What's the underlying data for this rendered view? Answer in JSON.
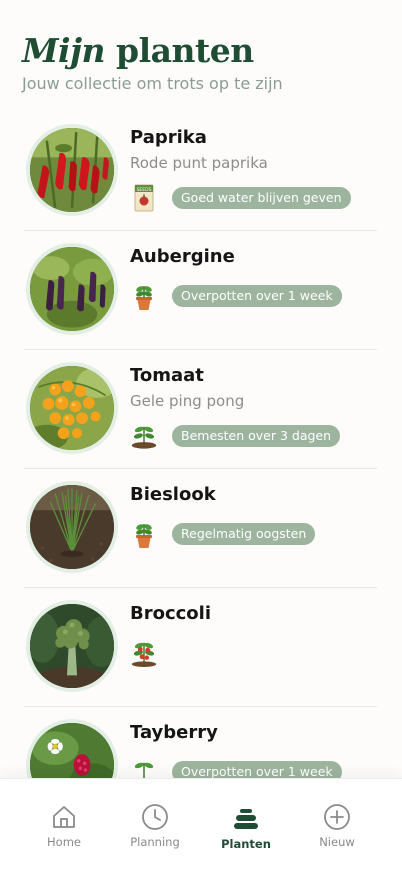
{
  "header": {
    "title_italic": "Mijn",
    "title_rest": "planten",
    "subtitle": "Jouw collectie om trots op te zijn"
  },
  "plants": [
    {
      "name": "Paprika",
      "variety": "Rode punt paprika",
      "status_icon": "seed-packet-icon",
      "status": "Goed water blijven geven"
    },
    {
      "name": "Aubergine",
      "variety": "",
      "status_icon": "potted-plant-icon",
      "status": "Overpotten over 1 week"
    },
    {
      "name": "Tomaat",
      "variety": "Gele ping pong",
      "status_icon": "sprout-soil-icon",
      "status": "Bemesten over 3 dagen"
    },
    {
      "name": "Bieslook",
      "variety": "",
      "status_icon": "potted-plant-icon",
      "status": "Regelmatig oogsten"
    },
    {
      "name": "Broccoli",
      "variety": "",
      "status_icon": "fruiting-plant-icon",
      "status": ""
    },
    {
      "name": "Tayberry",
      "variety": "",
      "status_icon": "sprout-soil-icon",
      "status": "Overpotten over 1 week"
    }
  ],
  "tabs": [
    {
      "label": "Home",
      "icon": "home-icon"
    },
    {
      "label": "Planning",
      "icon": "clock-icon"
    },
    {
      "label": "Planten",
      "icon": "plant-stack-icon",
      "active": true
    },
    {
      "label": "Nieuw",
      "icon": "plus-circle-icon"
    }
  ],
  "colors": {
    "brand": "#1f4d34",
    "pill": "#9db59f",
    "thumb_ring": "#e3efe4"
  }
}
